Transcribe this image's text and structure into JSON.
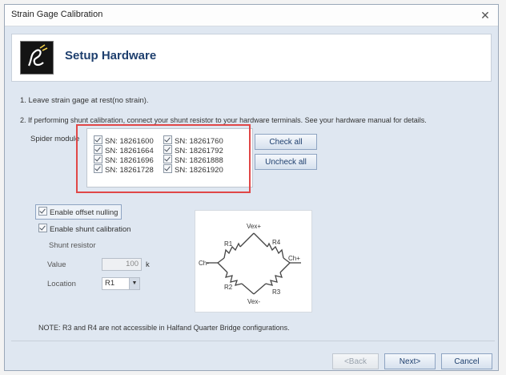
{
  "window": {
    "title": "Strain Gage Calibration"
  },
  "header": {
    "title": "Setup Hardware",
    "logo_icon": "strain-gage-logo-icon"
  },
  "instructions": {
    "step1": "1. Leave strain gage at rest(no strain).",
    "step2": "2. If performing shunt calibration, connect your shunt resistor to your hardware terminals. See your hardware manual for details."
  },
  "modules": {
    "label": "Spider module",
    "items": [
      "SN: 18261600",
      "SN: 18261760",
      "SN: 18261664",
      "SN: 18261792",
      "SN: 18261696",
      "SN: 18261888",
      "SN: 18261728",
      "SN: 18261920"
    ],
    "check_all": "Check all",
    "uncheck_all": "Uncheck all",
    "highlight_color": "#e04747"
  },
  "options": {
    "offset_nulling": "Enable offset nulling",
    "shunt_calibration": "Enable shunt calibration"
  },
  "shunt": {
    "group_title": "Shunt resistor",
    "value_label": "Value",
    "value": "100",
    "unit": "k",
    "location_label": "Location",
    "location_value": "R1"
  },
  "diagram": {
    "top": "Vex+",
    "bottom": "Vex-",
    "left": "Ch-",
    "right": "Ch+",
    "r1": "R1",
    "r2": "R2",
    "r3": "R3",
    "r4": "R4"
  },
  "note": "NOTE: R3 and R4 are not accessible in Halfand Quarter Bridge configurations.",
  "footer": {
    "back": "<Back",
    "next": "Next>",
    "cancel": "Cancel"
  }
}
